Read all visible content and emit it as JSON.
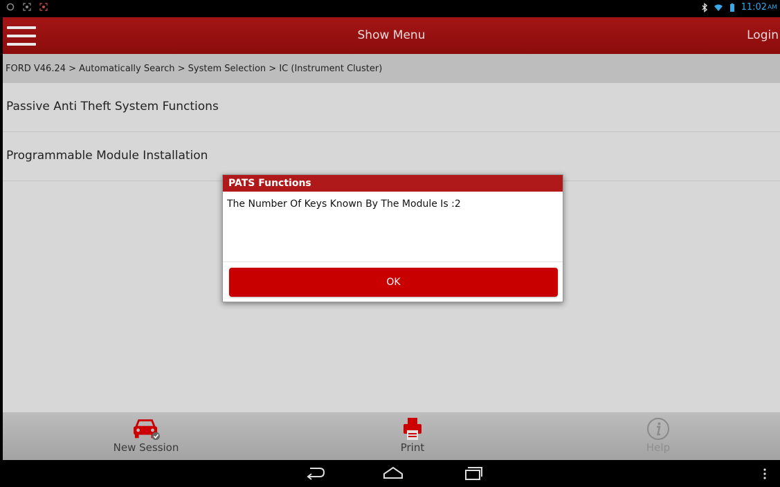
{
  "status_bar": {
    "time": "11:02",
    "ampm": "AM"
  },
  "top_bar": {
    "title": "Show Menu",
    "login_label": "Login"
  },
  "breadcrumb": "FORD V46.24 > Automatically Search > System Selection > IC (Instrument Cluster)",
  "menu_items": [
    {
      "label": "Passive Anti Theft System Functions"
    },
    {
      "label": "Programmable Module Installation"
    }
  ],
  "dialog": {
    "title": "PATS Functions",
    "message": "The Number Of Keys Known By The Module Is :2",
    "ok_label": "OK"
  },
  "bottom_bar": {
    "new_session_label": "New Session",
    "print_label": "Print",
    "help_label": "Help"
  },
  "colors": {
    "header_red": "#a31515",
    "accent_red": "#c80000",
    "clock_blue": "#39a8e8"
  }
}
